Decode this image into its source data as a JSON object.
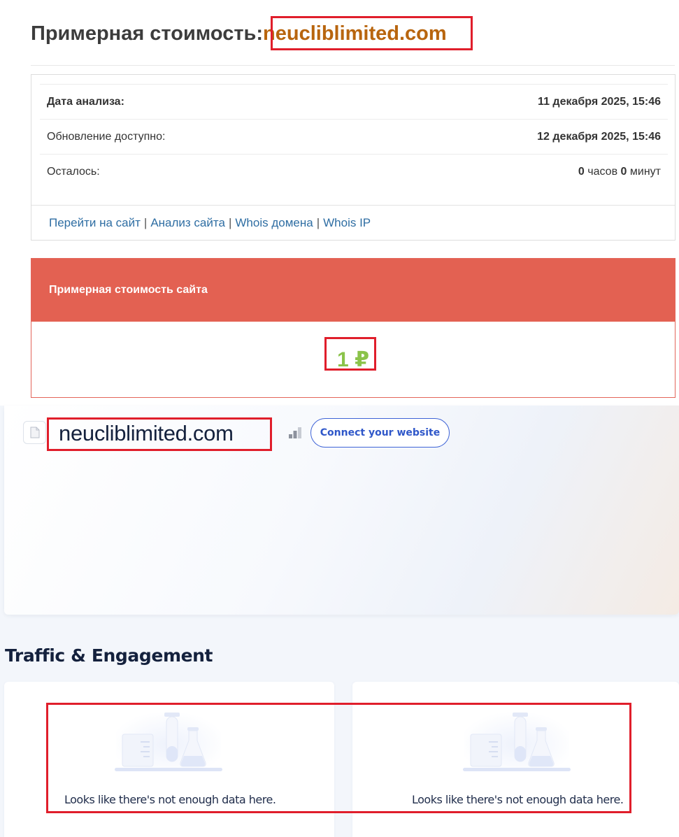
{
  "header": {
    "prefix": "Примерная стоимость:",
    "domain": "neucliblimited.com"
  },
  "info": {
    "rows": [
      {
        "label": "Дата анализа:",
        "value": "11 декабря 2025, 15:46"
      },
      {
        "label": "Обновление доступно:",
        "value": "12 декабря 2025, 15:46"
      },
      {
        "label": "Осталось:",
        "hours": "0",
        "hours_unit": "часов",
        "minutes": "0",
        "minutes_unit": "минут"
      }
    ],
    "links": [
      "Перейти на сайт",
      "Анализ сайта",
      "Whois домена",
      "Whois IP"
    ],
    "separator": "|"
  },
  "estimate": {
    "title": "Примерная стоимость сайта",
    "value": "1 ₽"
  },
  "site": {
    "domain": "neucliblimited.com",
    "connect_label": "Connect your website",
    "favicon_icon": "document-icon",
    "rank_icon": "signal-bars-icon"
  },
  "traffic": {
    "title": "Traffic & Engagement",
    "panels": [
      {
        "empty_text": "Looks like there's not enough data here.",
        "illustration": "lab-flask-icon"
      },
      {
        "empty_text": "Looks like there's not enough data here.",
        "illustration": "lab-flask-icon"
      }
    ]
  },
  "colors": {
    "domain_accent": "#b8650e",
    "estimate_header": "#e36152",
    "estimate_value": "#8bc34a",
    "link": "#2f6ea3",
    "connect_button": "#3e63d6",
    "highlight_box": "#e01e2b"
  }
}
